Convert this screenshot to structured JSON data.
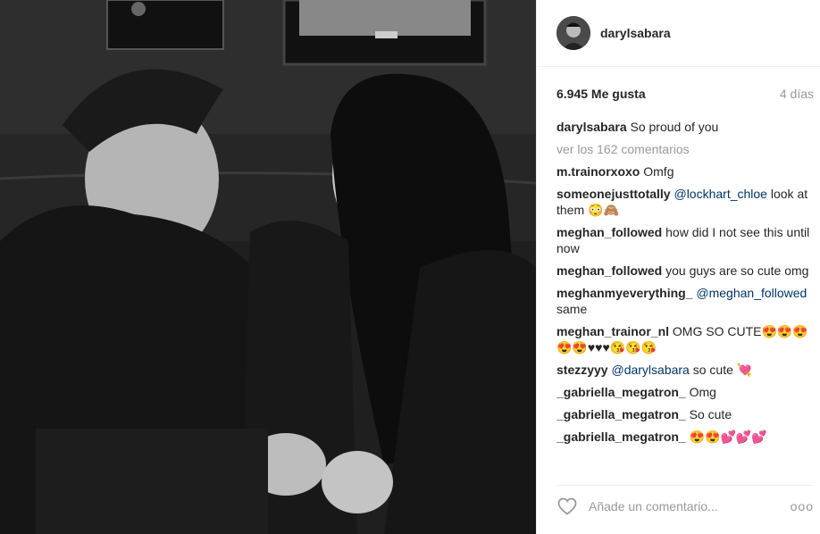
{
  "post": {
    "author": "darylsabara",
    "likes": "6.945 Me gusta",
    "time": "4 días",
    "caption_user": "darylsabara",
    "caption_text": "So proud of you",
    "load_more": "ver los 162 comentarios",
    "comments": [
      {
        "user": "m.trainorxoxo",
        "mention": "",
        "text": "Omfg"
      },
      {
        "user": "someonejusttotally",
        "mention": "@lockhart_chloe",
        "text": "look at them 😳🙈"
      },
      {
        "user": "meghan_followed",
        "mention": "",
        "text": "how did I not see this until now"
      },
      {
        "user": "meghan_followed",
        "mention": "",
        "text": "you guys are so cute omg"
      },
      {
        "user": "meghanmyeverything_",
        "mention": "@meghan_followed",
        "text": "same"
      },
      {
        "user": "meghan_trainor_nl",
        "mention": "",
        "text": "OMG SO CUTE😍😍😍😍😍♥♥♥😘😘😘"
      },
      {
        "user": "stezzyyy",
        "mention": "@darylsabara",
        "text": "so cute 💘"
      },
      {
        "user": "_gabriella_megatron_",
        "mention": "",
        "text": "Omg"
      },
      {
        "user": "_gabriella_megatron_",
        "mention": "",
        "text": "So cute"
      },
      {
        "user": "_gabriella_megatron_",
        "mention": "",
        "text": "😍😍💕💕💕"
      }
    ],
    "add_comment_placeholder": "Añade un comentario...",
    "more_icon": "ooo"
  },
  "icons": {
    "heart": "heart-icon",
    "more": "more-options-icon"
  },
  "colors": {
    "username": "#262626",
    "mention": "#003569",
    "muted": "#999999",
    "border": "#efefef"
  }
}
